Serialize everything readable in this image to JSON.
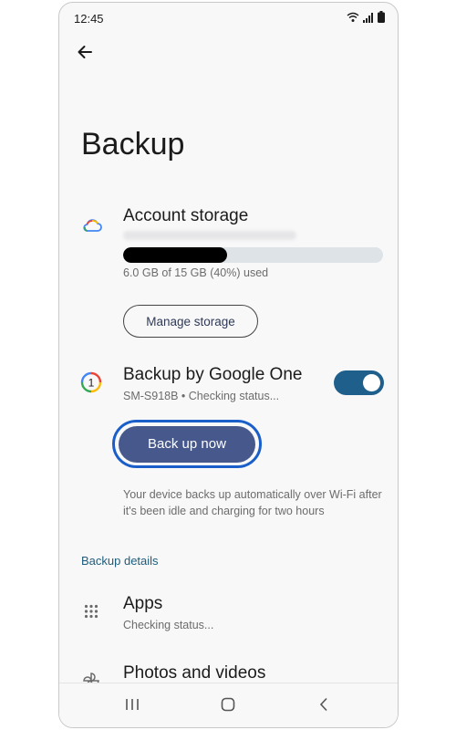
{
  "status": {
    "time": "12:45"
  },
  "page": {
    "title": "Backup"
  },
  "account_storage": {
    "title": "Account storage",
    "usage_text": "6.0 GB of 15 GB (40%) used",
    "used_fraction": 0.4,
    "manage_label": "Manage storage"
  },
  "google_one": {
    "title": "Backup by Google One",
    "status": "SM-S918B • Checking status...",
    "toggle_on": true,
    "backup_now_label": "Back up now",
    "info": "Your device backs up automatically over Wi-Fi after it's been idle and charging for two hours"
  },
  "backup_details": {
    "header": "Backup details",
    "items": [
      {
        "title": "Apps",
        "status": "Checking status..."
      },
      {
        "title": "Photos and videos"
      }
    ]
  },
  "colors": {
    "accent": "#1f5f8b",
    "button": "#47598c",
    "focus_ring": "#1a5fc9",
    "section_header": "#1e5c7a"
  },
  "icons": [
    "back-arrow-icon",
    "cloud-icon",
    "google-one-icon",
    "apps-grid-icon",
    "pinwheel-icon",
    "wifi-icon",
    "signal-icon",
    "battery-icon",
    "recents-icon",
    "home-icon",
    "back-nav-icon"
  ]
}
